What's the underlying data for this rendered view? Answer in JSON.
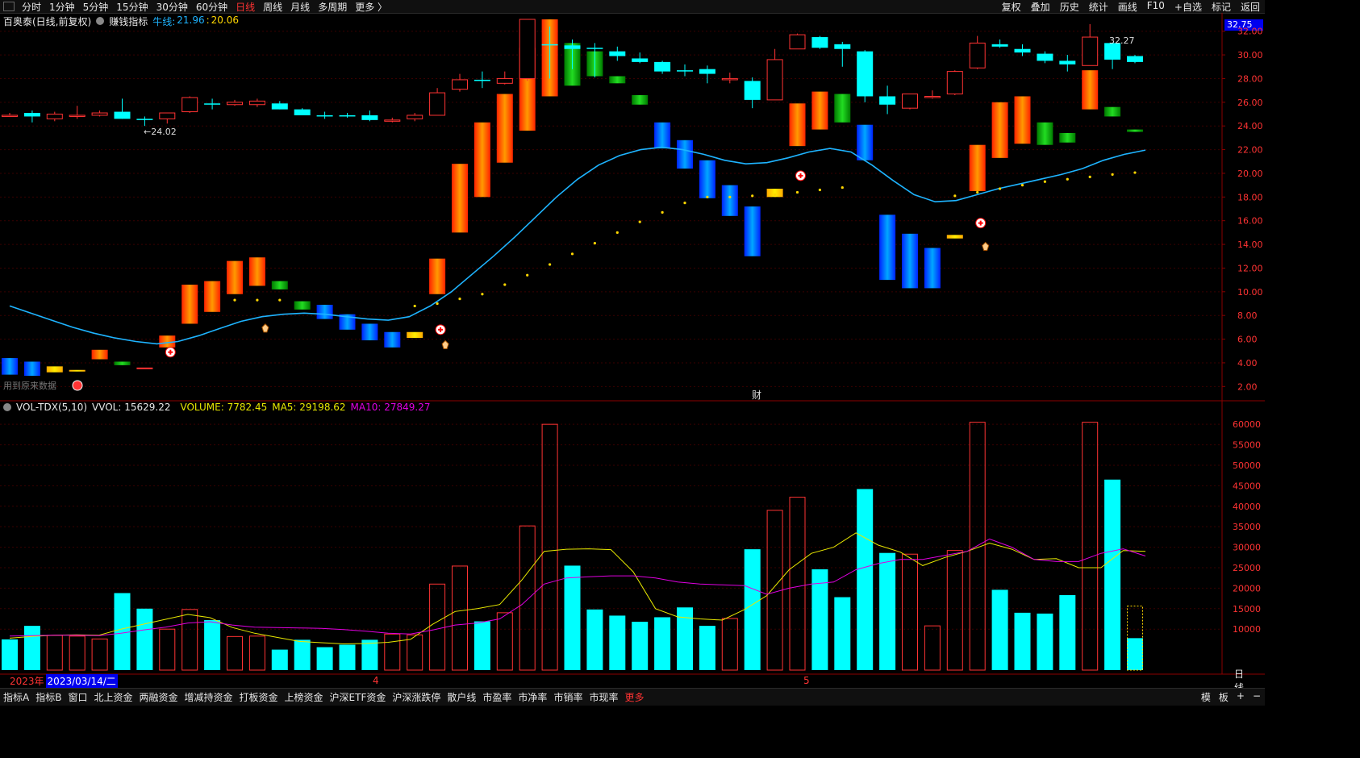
{
  "toolbar": {
    "tabs": [
      "分时",
      "1分钟",
      "5分钟",
      "15分钟",
      "30分钟",
      "60分钟",
      "日线",
      "周线",
      "月线",
      "多周期",
      "更多 〉"
    ],
    "active_tab": "日线",
    "right_buttons": [
      "复权",
      "叠加",
      "历史",
      "统计",
      "画线",
      "F10",
      "+自选",
      "标记",
      "返回"
    ]
  },
  "main_legend": {
    "stock": "百奥泰(日线,前复权)",
    "indicator_name": "赚钱指标",
    "line_label": "牛线:",
    "line_value_1": "21.96",
    "separator": ":",
    "line_value_2": "20.06"
  },
  "price_box": "32.75",
  "price_axis": [
    "32.00",
    "30.00",
    "28.00",
    "26.00",
    "24.00",
    "22.00",
    "20.00",
    "18.00",
    "16.00",
    "14.00",
    "12.00",
    "10.00",
    "8.00",
    "6.00",
    "4.00",
    "2.00"
  ],
  "annotations": {
    "low_label": "←24.02",
    "high_label": "32.27",
    "finance_marker": "财",
    "left_caption": "用到原来数据"
  },
  "vol_legend": {
    "name": "VOL-TDX(5,10)",
    "vvol": "VVOL: 15629.22",
    "volume": "VOLUME: 7782.45",
    "ma5": "MA5: 29198.62",
    "ma10": "MA10: 27849.27"
  },
  "vol_axis": [
    "60000",
    "55000",
    "50000",
    "45000",
    "40000",
    "35000",
    "30000",
    "25000",
    "20000",
    "15000",
    "10000"
  ],
  "date_row": {
    "year": "2023年",
    "cursor_date": "2023/03/14/二",
    "month_4": "4",
    "month_5": "5",
    "period": "日线"
  },
  "bottom_tabs": [
    "指标A",
    "指标B",
    "窗口",
    "北上资金",
    "两融资金",
    "增减持资金",
    "打板资金",
    "上榜资金",
    "沪深ETF资金",
    "沪深涨跌停",
    "散户线",
    "市盈率",
    "市净率",
    "市销率",
    "市现率",
    "更多"
  ],
  "bottom_right": [
    "模",
    "板",
    "+",
    "−"
  ],
  "colors": {
    "up": "#ff3333",
    "down": "#00ffff",
    "green": "#00c000",
    "blue": "#0050ff",
    "orange": "#ff6a00",
    "yellow": "#ffd700",
    "line": "#1eb4ff",
    "ma5": "#e8e800",
    "ma10": "#e000e0"
  },
  "chart_data": {
    "type": "candlestick",
    "price_range": [
      1.0,
      33.0
    ],
    "volume_range": [
      0,
      62000
    ],
    "candles": [
      {
        "o": 24.9,
        "h": 25.1,
        "l": 24.8,
        "c": 24.9,
        "dir": "doji",
        "band": "blue",
        "bl": 3.0,
        "bh": 4.4
      },
      {
        "o": 24.8,
        "h": 25.3,
        "l": 24.3,
        "c": 25.1,
        "dir": "down",
        "band": "blue",
        "bl": 2.9,
        "bh": 4.1
      },
      {
        "o": 24.6,
        "h": 25.2,
        "l": 24.4,
        "c": 25.0,
        "dir": "up",
        "band": "yellow",
        "bl": 3.2,
        "bh": 3.7
      },
      {
        "o": 24.8,
        "h": 25.7,
        "l": 24.6,
        "c": 24.9,
        "dir": "up",
        "band": "yellow",
        "bl": 3.4,
        "bh": 3.4
      },
      {
        "o": 24.9,
        "h": 25.3,
        "l": 24.8,
        "c": 25.1,
        "dir": "up",
        "band": "orange",
        "bl": 4.3,
        "bh": 5.1
      },
      {
        "o": 25.2,
        "h": 26.3,
        "l": 24.6,
        "c": 24.6,
        "dir": "down",
        "band": "green",
        "bl": 3.8,
        "bh": 4.1
      },
      {
        "o": 24.6,
        "h": 24.8,
        "l": 24.0,
        "c": 24.6,
        "dir": "down",
        "band": "red",
        "bl": 3.6,
        "bh": 3.6
      },
      {
        "o": 24.6,
        "h": 25.1,
        "l": 24.2,
        "c": 25.1,
        "dir": "up",
        "band": "orange",
        "bl": 5.3,
        "bh": 6.3
      },
      {
        "o": 25.2,
        "h": 26.5,
        "l": 25.1,
        "c": 26.4,
        "dir": "up",
        "band": "orange",
        "bl": 7.3,
        "bh": 10.6
      },
      {
        "o": 25.8,
        "h": 26.3,
        "l": 25.4,
        "c": 25.9,
        "dir": "down",
        "band": "orange",
        "bl": 8.3,
        "bh": 10.9
      },
      {
        "o": 25.8,
        "h": 26.2,
        "l": 25.7,
        "c": 26.0,
        "dir": "up",
        "band": "orange",
        "bl": 9.8,
        "bh": 12.6
      },
      {
        "o": 25.8,
        "h": 26.3,
        "l": 25.6,
        "c": 26.1,
        "dir": "up",
        "band": "orange",
        "bl": 10.5,
        "bh": 12.9
      },
      {
        "o": 25.9,
        "h": 26.1,
        "l": 25.4,
        "c": 25.4,
        "dir": "down",
        "band": "green",
        "bl": 10.2,
        "bh": 10.9
      },
      {
        "o": 25.4,
        "h": 25.5,
        "l": 24.9,
        "c": 24.9,
        "dir": "down",
        "band": "green",
        "bl": 8.5,
        "bh": 9.2
      },
      {
        "o": 24.9,
        "h": 25.2,
        "l": 24.6,
        "c": 24.9,
        "dir": "down",
        "band": "blue",
        "bl": 7.7,
        "bh": 8.9
      },
      {
        "o": 24.8,
        "h": 25.1,
        "l": 24.7,
        "c": 24.9,
        "dir": "down",
        "band": "blue",
        "bl": 6.8,
        "bh": 8.1
      },
      {
        "o": 24.9,
        "h": 25.3,
        "l": 24.4,
        "c": 24.5,
        "dir": "down",
        "band": "blue",
        "bl": 5.9,
        "bh": 7.3
      },
      {
        "o": 24.5,
        "h": 24.7,
        "l": 24.3,
        "c": 24.5,
        "dir": "up",
        "band": "blue",
        "bl": 5.3,
        "bh": 6.6
      },
      {
        "o": 24.6,
        "h": 25.1,
        "l": 24.4,
        "c": 24.9,
        "dir": "up",
        "band": "yellow",
        "bl": 6.1,
        "bh": 6.6
      },
      {
        "o": 24.9,
        "h": 27.2,
        "l": 24.9,
        "c": 26.8,
        "dir": "up",
        "band": "orange",
        "bl": 9.8,
        "bh": 12.8
      },
      {
        "o": 27.1,
        "h": 28.4,
        "l": 26.9,
        "c": 27.9,
        "dir": "up",
        "band": "orange",
        "bl": 15.0,
        "bh": 20.8
      },
      {
        "o": 27.8,
        "h": 28.6,
        "l": 27.2,
        "c": 27.9,
        "dir": "down",
        "band": "orange",
        "bl": 18.0,
        "bh": 24.3
      },
      {
        "o": 27.6,
        "h": 28.6,
        "l": 27.5,
        "c": 28.0,
        "dir": "up",
        "band": "orange",
        "bl": 20.9,
        "bh": 26.7
      },
      {
        "o": 28.0,
        "h": 33.0,
        "l": 27.8,
        "c": 33.0,
        "dir": "up",
        "band": "orange",
        "bl": 23.6,
        "bh": 30.6
      },
      {
        "o": 30.8,
        "h": 32.4,
        "l": 28.0,
        "c": 30.9,
        "dir": "down",
        "band": "orange",
        "bl": 26.5,
        "bh": 33.0
      },
      {
        "o": 30.8,
        "h": 31.3,
        "l": 28.8,
        "c": 30.5,
        "dir": "down",
        "band": "green",
        "bl": 27.4,
        "bh": 31.0
      },
      {
        "o": 30.6,
        "h": 31.0,
        "l": 28.1,
        "c": 30.6,
        "dir": "down",
        "band": "green",
        "bl": 28.2,
        "bh": 30.3
      },
      {
        "o": 30.3,
        "h": 30.7,
        "l": 29.5,
        "c": 29.9,
        "dir": "down",
        "band": "green",
        "bl": 27.6,
        "bh": 28.2
      },
      {
        "o": 29.7,
        "h": 30.2,
        "l": 29.3,
        "c": 29.4,
        "dir": "down",
        "band": "green",
        "bl": 25.8,
        "bh": 26.6
      },
      {
        "o": 29.4,
        "h": 29.5,
        "l": 28.4,
        "c": 28.6,
        "dir": "down",
        "band": "blue",
        "bl": 22.1,
        "bh": 24.3
      },
      {
        "o": 28.7,
        "h": 29.2,
        "l": 28.2,
        "c": 28.7,
        "dir": "down",
        "band": "blue",
        "bl": 20.4,
        "bh": 22.8
      },
      {
        "o": 28.8,
        "h": 29.1,
        "l": 27.6,
        "c": 28.4,
        "dir": "down",
        "band": "blue",
        "bl": 17.9,
        "bh": 21.1
      },
      {
        "o": 28.0,
        "h": 28.5,
        "l": 27.6,
        "c": 28.0,
        "dir": "up",
        "band": "blue",
        "bl": 16.4,
        "bh": 19.0
      },
      {
        "o": 27.8,
        "h": 28.1,
        "l": 25.5,
        "c": 26.2,
        "dir": "down",
        "band": "blue",
        "bl": 13.0,
        "bh": 17.2
      },
      {
        "o": 26.2,
        "h": 30.5,
        "l": 26.2,
        "c": 29.6,
        "dir": "up",
        "band": "yellow",
        "bl": 18.0,
        "bh": 18.7
      },
      {
        "o": 30.5,
        "h": 31.8,
        "l": 30.5,
        "c": 31.7,
        "dir": "up",
        "band": "orange",
        "bl": 22.3,
        "bh": 25.9
      },
      {
        "o": 31.5,
        "h": 31.6,
        "l": 30.5,
        "c": 30.6,
        "dir": "down",
        "band": "orange",
        "bl": 23.7,
        "bh": 26.9
      },
      {
        "o": 30.9,
        "h": 31.1,
        "l": 29.0,
        "c": 30.5,
        "dir": "down",
        "band": "green",
        "bl": 24.3,
        "bh": 26.7
      },
      {
        "o": 30.3,
        "h": 30.4,
        "l": 26.0,
        "c": 26.5,
        "dir": "down",
        "band": "blue",
        "bl": 21.1,
        "bh": 24.1
      },
      {
        "o": 26.5,
        "h": 27.4,
        "l": 25.0,
        "c": 25.8,
        "dir": "down",
        "band": "blue",
        "bl": 11.0,
        "bh": 16.5
      },
      {
        "o": 25.5,
        "h": 26.6,
        "l": 25.4,
        "c": 26.7,
        "dir": "up",
        "band": "blue",
        "bl": 10.3,
        "bh": 14.9
      },
      {
        "o": 26.5,
        "h": 27.0,
        "l": 26.3,
        "c": 26.5,
        "dir": "up",
        "band": "blue",
        "bl": 10.3,
        "bh": 13.7
      },
      {
        "o": 26.7,
        "h": 28.7,
        "l": 26.6,
        "c": 28.6,
        "dir": "up",
        "band": "yellow",
        "bl": 14.5,
        "bh": 14.8
      },
      {
        "o": 28.9,
        "h": 31.6,
        "l": 28.8,
        "c": 31.0,
        "dir": "up",
        "band": "orange",
        "bl": 18.5,
        "bh": 22.4
      },
      {
        "o": 30.9,
        "h": 31.3,
        "l": 30.6,
        "c": 30.7,
        "dir": "down",
        "band": "orange",
        "bl": 21.3,
        "bh": 26.0
      },
      {
        "o": 30.2,
        "h": 30.9,
        "l": 29.9,
        "c": 30.5,
        "dir": "down",
        "band": "orange",
        "bl": 22.5,
        "bh": 26.5
      },
      {
        "o": 30.1,
        "h": 30.3,
        "l": 29.3,
        "c": 29.5,
        "dir": "down",
        "band": "green",
        "bl": 22.4,
        "bh": 24.3
      },
      {
        "o": 29.5,
        "h": 30.0,
        "l": 28.6,
        "c": 29.2,
        "dir": "down",
        "band": "green",
        "bl": 22.6,
        "bh": 23.4
      },
      {
        "o": 29.1,
        "h": 32.6,
        "l": 29.1,
        "c": 31.5,
        "dir": "up",
        "band": "orange",
        "bl": 25.4,
        "bh": 28.7
      },
      {
        "o": 31.0,
        "h": 31.0,
        "l": 28.8,
        "c": 29.6,
        "dir": "down",
        "band": "green",
        "bl": 24.8,
        "bh": 25.6
      },
      {
        "o": 29.4,
        "h": 30.0,
        "l": 29.3,
        "c": 29.9,
        "dir": "down",
        "band": "green",
        "bl": 23.5,
        "bh": 23.7
      }
    ],
    "bull_line": [
      8.8,
      8.2,
      7.6,
      7.0,
      6.5,
      6.1,
      5.8,
      5.6,
      5.8,
      6.3,
      6.9,
      7.5,
      7.9,
      8.1,
      8.2,
      8.1,
      7.9,
      7.7,
      7.6,
      7.9,
      8.8,
      10.0,
      11.5,
      13.0,
      14.6,
      16.3,
      18.0,
      19.5,
      20.7,
      21.5,
      22.0,
      22.2,
      22.0,
      21.6,
      21.1,
      20.8,
      20.9,
      21.3,
      21.8,
      22.1,
      21.8,
      20.7,
      19.4,
      18.2,
      17.6,
      17.7,
      18.2,
      18.7,
      19.1,
      19.5,
      19.9,
      20.4,
      21.1,
      21.6,
      21.96
    ],
    "dots": [
      null,
      null,
      null,
      null,
      null,
      null,
      null,
      null,
      null,
      null,
      9.3,
      9.3,
      9.3,
      null,
      null,
      null,
      null,
      null,
      8.8,
      9.0,
      9.4,
      9.8,
      10.6,
      11.4,
      12.3,
      13.2,
      14.1,
      15.0,
      15.9,
      16.7,
      17.5,
      18.0,
      18.0,
      18.1,
      18.2,
      18.4,
      18.6,
      18.8,
      null,
      null,
      null,
      null,
      18.1,
      18.4,
      18.7,
      19.0,
      19.3,
      19.5,
      19.7,
      19.9,
      20.06
    ],
    "volume": [
      7500,
      10800,
      8500,
      8300,
      7600,
      18800,
      15000,
      10000,
      14800,
      12200,
      8200,
      8300,
      5000,
      7400,
      5600,
      6200,
      7400,
      8800,
      8600,
      21000,
      25400,
      11900,
      14000,
      35200,
      60000,
      25500,
      14800,
      13300,
      11800,
      12900,
      15300,
      10800,
      12600,
      29500,
      39000,
      42200,
      24600,
      17800,
      44200,
      28600,
      28300,
      10800,
      29200,
      60500,
      19600,
      14000,
      13800,
      18300,
      60500,
      46500,
      7800
    ],
    "vol_up": [
      false,
      false,
      true,
      true,
      true,
      false,
      false,
      true,
      true,
      false,
      true,
      true,
      false,
      false,
      false,
      false,
      false,
      true,
      true,
      true,
      true,
      false,
      true,
      true,
      true,
      false,
      false,
      false,
      false,
      false,
      false,
      false,
      true,
      false,
      true,
      true,
      false,
      false,
      false,
      false,
      true,
      true,
      true,
      true,
      false,
      false,
      false,
      false,
      true,
      false,
      false
    ],
    "ma5": [
      7800,
      8200,
      8500,
      8600,
      8500,
      10000,
      11200,
      12400,
      13600,
      12800,
      10400,
      9000,
      8000,
      7000,
      6700,
      6400,
      6500,
      6800,
      7500,
      11200,
      14300,
      15000,
      16000,
      22000,
      29000,
      29500,
      29600,
      29400,
      24000,
      15000,
      13000,
      12500,
      12200,
      14800,
      18200,
      24500,
      28500,
      30000,
      33500,
      30500,
      28800,
      25500,
      27500,
      29000,
      31000,
      29500,
      27000,
      27200,
      25000,
      25000,
      29198.62,
      29000
    ],
    "ma10": [
      8300,
      8400,
      8500,
      8500,
      8400,
      9000,
      9800,
      10500,
      11500,
      11800,
      11000,
      10500,
      10400,
      10300,
      10200,
      9900,
      9500,
      9000,
      8800,
      9800,
      11000,
      11500,
      12500,
      16000,
      21000,
      22500,
      22800,
      23000,
      23000,
      22500,
      21500,
      21000,
      20800,
      20600,
      18500,
      20000,
      21000,
      21500,
      24500,
      26000,
      27000,
      27000,
      28000,
      29000,
      32000,
      30000,
      27000,
      26500,
      26500,
      28500,
      29600,
      27849.27
    ]
  }
}
